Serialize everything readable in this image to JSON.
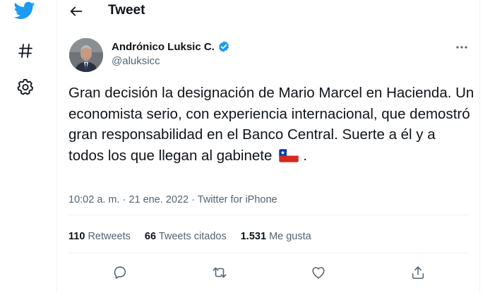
{
  "colors": {
    "brand": "#1d9bf0",
    "text_primary": "#0f1419",
    "text_secondary": "#536471",
    "divider": "#eff3f4"
  },
  "nav": {
    "icons": [
      "twitter-logo",
      "hashtag-icon",
      "settings-gear-icon"
    ]
  },
  "header": {
    "title": "Tweet",
    "back_icon": "arrow-left-icon"
  },
  "tweet": {
    "author": {
      "name": "Andrónico Luksic C.",
      "handle": "@aluksicc",
      "verified": true
    },
    "text_main": "Gran decisión la designación de Mario Marcel en Hacienda. Un economista serio, con experiencia internacional, que demostró gran responsabilidad en el Banco Central. Suerte a él y a todos los que llegan al gabinete",
    "text_end": ".",
    "emoji": "chile-flag",
    "time": "10:02 a. m.",
    "date": "21 ene. 2022",
    "separator": "·",
    "source": "Twitter for iPhone"
  },
  "stats": {
    "retweets_count": "110",
    "retweets_label": "Retweets",
    "quotes_count": "66",
    "quotes_label": "Tweets citados",
    "likes_count": "1.531",
    "likes_label": "Me gusta"
  },
  "actions": [
    "reply-icon",
    "retweet-icon",
    "like-icon",
    "share-icon"
  ]
}
